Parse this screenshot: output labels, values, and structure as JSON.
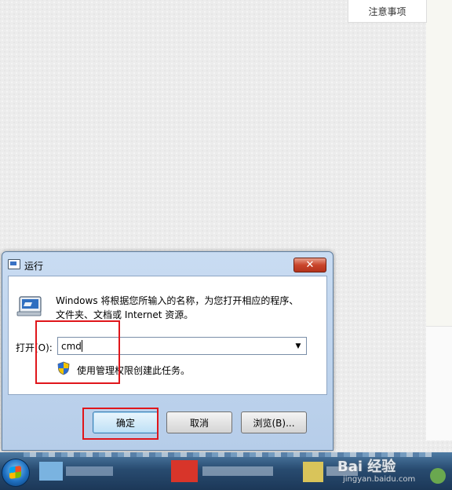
{
  "top_tab": {
    "label": "注意事项"
  },
  "run_dialog": {
    "title": "运行",
    "close_label": "✕",
    "description": "Windows 将根据您所输入的名称，为您打开相应的程序、文件夹、文档或 Internet 资源。",
    "open_label": "打开(O):",
    "command_value": "cmd",
    "admin_note": "使用管理权限创建此任务。",
    "buttons": {
      "ok": "确定",
      "cancel": "取消",
      "browse": "浏览(B)..."
    }
  },
  "watermark": {
    "brand": "Bai 经验",
    "url": "jingyan.baidu.com"
  },
  "colors": {
    "highlight_box": "#e0161b",
    "dialog_frame": "#b6cde9",
    "taskbar": "#284b70"
  }
}
